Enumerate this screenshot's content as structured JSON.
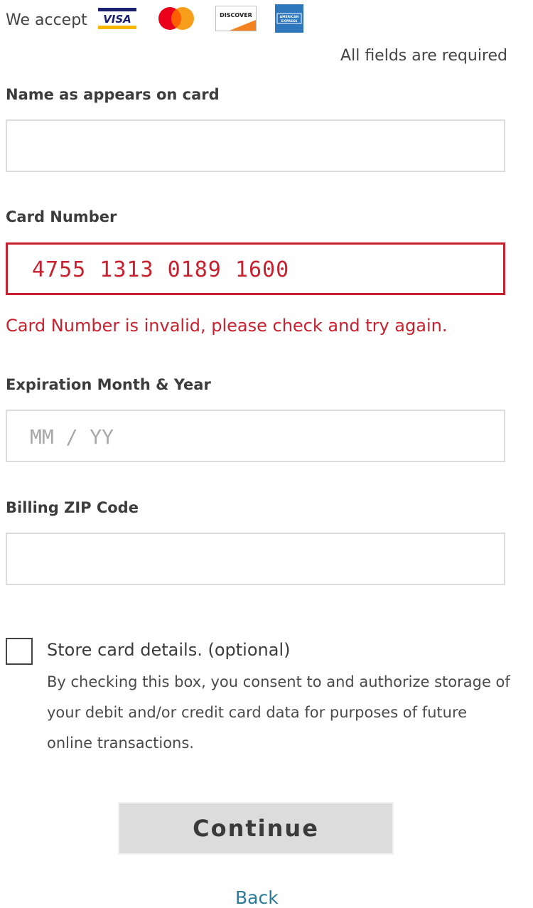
{
  "header": {
    "accept_label": "We accept",
    "cards": [
      "visa-logo",
      "mastercard-logo",
      "discover-logo",
      "american-express-logo"
    ],
    "visa_text": "VISA",
    "discover_text": "DISCOVER",
    "amex_text": "AMERICAN EXPRESS",
    "required_note": "All fields are required"
  },
  "fields": {
    "name": {
      "label": "Name as appears on card",
      "value": ""
    },
    "card_number": {
      "label": "Card Number",
      "value": "4755 1313 0189 1600",
      "error": "Card Number is invalid, please check and try again."
    },
    "expiration": {
      "label": "Expiration Month & Year",
      "placeholder": "MM / YY",
      "value": ""
    },
    "zip": {
      "label": "Billing ZIP Code",
      "value": ""
    }
  },
  "store_card": {
    "checked": false,
    "title": "Store card details. (optional)",
    "consent": "By checking this box, you consent to and authorize storage of your debit and/or credit card data for purposes of future online transactions."
  },
  "actions": {
    "continue_label": "Continue",
    "back_label": "Back"
  },
  "colors": {
    "error": "#c8202e",
    "link": "#2a7a9a",
    "button_bg": "#dcdcdc",
    "field_border": "#dcdcdc"
  }
}
